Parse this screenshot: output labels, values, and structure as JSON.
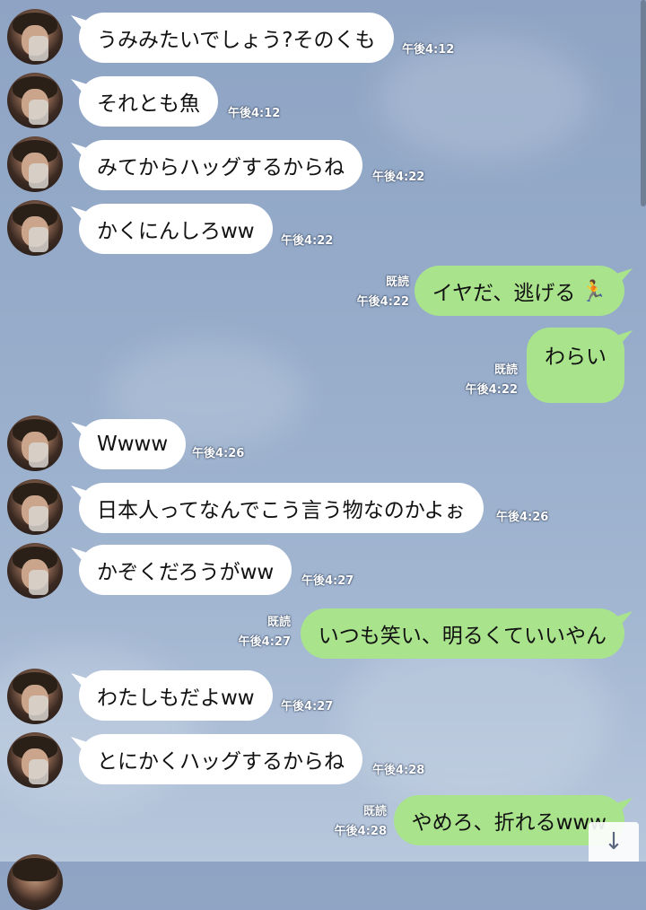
{
  "messages": [
    {
      "dir": "in",
      "text": "うみみたいでしょう?そのくも",
      "time": "午後4:12"
    },
    {
      "dir": "in",
      "text": "それとも魚",
      "time": "午後4:12"
    },
    {
      "dir": "in",
      "text": "みてからハッグするからね",
      "time": "午後4:22"
    },
    {
      "dir": "in",
      "text": "かくにんしろww",
      "time": "午後4:22"
    },
    {
      "dir": "out",
      "text": "イヤだ、逃げる",
      "emoji": "🏃",
      "read": "既読",
      "time": "午後4:22"
    },
    {
      "dir": "out",
      "text": "わらい",
      "read": "既読",
      "time": "午後4:22"
    },
    {
      "dir": "in",
      "text": "Wwww",
      "time": "午後4:26"
    },
    {
      "dir": "in",
      "text": "日本人ってなんでこう言う物なのかよぉ",
      "time": "午後4:26"
    },
    {
      "dir": "in",
      "text": "かぞくだろうがww",
      "time": "午後4:27"
    },
    {
      "dir": "out",
      "text": "いつも笑い、明るくていいやん",
      "read": "既読",
      "time": "午後4:27"
    },
    {
      "dir": "in",
      "text": "わたしもだよww",
      "time": "午後4:27"
    },
    {
      "dir": "in",
      "text": "とにかくハッグするからね",
      "time": "午後4:28"
    },
    {
      "dir": "out",
      "text": "やめろ、折れるwww",
      "read": "既読",
      "time": "午後4:28"
    }
  ],
  "scroll_down_icon": "arrow-down-icon",
  "colors": {
    "incoming": "#ffffff",
    "outgoing": "#a9e38c",
    "background": "#95abc9"
  }
}
